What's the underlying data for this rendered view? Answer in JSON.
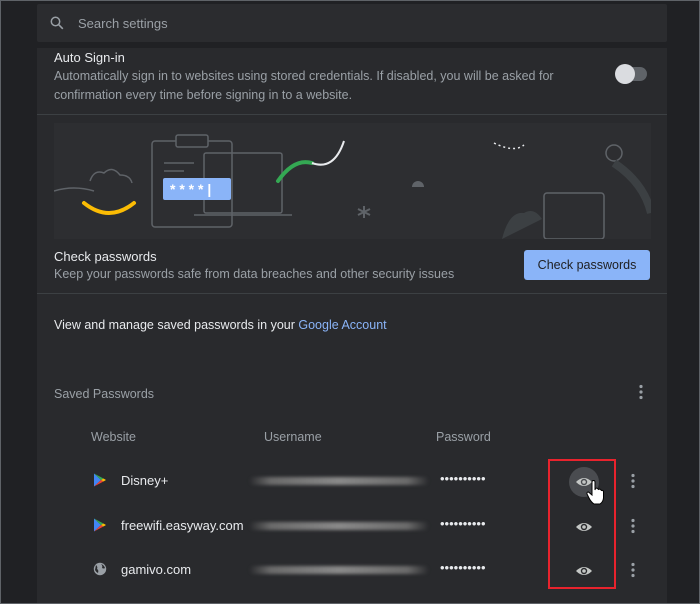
{
  "search": {
    "placeholder": "Search settings"
  },
  "auto_signin": {
    "title": "Auto Sign-in",
    "description": "Automatically sign in to websites using stored credentials. If disabled, you will be asked for confirmation every time before signing in to a website.",
    "enabled": false
  },
  "illustration": {
    "password_field_text": "* * * * |"
  },
  "check_passwords": {
    "title": "Check passwords",
    "description": "Keep your passwords safe from data breaches and other security issues",
    "button_label": "Check passwords"
  },
  "manage": {
    "text": "View and manage saved passwords in your ",
    "link": "Google Account"
  },
  "saved_passwords": {
    "title": "Saved Passwords",
    "columns": {
      "website": "Website",
      "username": "Username",
      "password": "Password"
    },
    "rows": [
      {
        "site": "Disney+",
        "icon": "play-store-icon",
        "password": "••••••••••"
      },
      {
        "site": "freewifi.easyway.com",
        "icon": "play-store-icon",
        "password": "••••••••••"
      },
      {
        "site": "gamivo.com",
        "icon": "globe-icon",
        "password": "••••••••••"
      }
    ]
  },
  "colors": {
    "background": "#202124",
    "card": "#292a2d",
    "accent": "#8ab4f8",
    "highlight": "#e8232d"
  }
}
